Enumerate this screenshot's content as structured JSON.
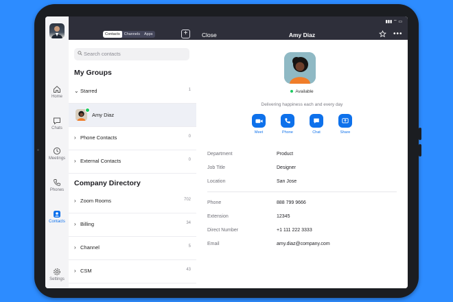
{
  "status": {
    "signal": "▮▮▮ ⌔ ▭"
  },
  "rail": {
    "items": [
      {
        "label": "Home"
      },
      {
        "label": "Chats"
      },
      {
        "label": "Meetings"
      },
      {
        "label": "Phones"
      },
      {
        "label": "Contacts"
      },
      {
        "label": "Settings"
      }
    ]
  },
  "contacts_pane": {
    "tabs": [
      "Contacts",
      "Channels",
      "Apps"
    ],
    "add_button": "+",
    "search_placeholder": "Search contacts",
    "groups_title": "My Groups",
    "groups": [
      {
        "name": "Starred",
        "count": "1"
      },
      {
        "name": "Amy Diaz",
        "count": ""
      },
      {
        "name": "Phone Contacts",
        "count": "0"
      },
      {
        "name": "External Contacts",
        "count": "0"
      }
    ],
    "directory_title": "Company Directory",
    "directory": [
      {
        "name": "Zoom Rooms",
        "count": "702"
      },
      {
        "name": "Billing",
        "count": "34"
      },
      {
        "name": "Channel",
        "count": "5"
      },
      {
        "name": "CSM",
        "count": "43"
      }
    ]
  },
  "detail": {
    "close_label": "Close",
    "title": "Amy Diaz",
    "more": "•••",
    "status": "Available",
    "status_color": "#1dc961",
    "motto": "Delivering happiness each and every day",
    "actions": [
      {
        "label": "Meet",
        "icon": "video-camera-icon"
      },
      {
        "label": "Phone",
        "icon": "phone-icon"
      },
      {
        "label": "Chat",
        "icon": "chat-bubble-icon"
      },
      {
        "label": "Share",
        "icon": "share-screen-icon"
      }
    ],
    "fields": [
      {
        "key": "Department",
        "value": "Product"
      },
      {
        "key": "Job Title",
        "value": "Designer"
      },
      {
        "key": "Location",
        "value": "San Jose"
      },
      {
        "key": "Phone",
        "value": "888 799 9666"
      },
      {
        "key": "Extension",
        "value": "12345"
      },
      {
        "key": "Direct Number",
        "value": "+1 111 222 3333"
      },
      {
        "key": "Email",
        "value": "amy.diaz@company.com"
      }
    ]
  },
  "colors": {
    "accent": "#0e71eb",
    "header": "#2e2f3a",
    "background": "#2D8CFF"
  }
}
